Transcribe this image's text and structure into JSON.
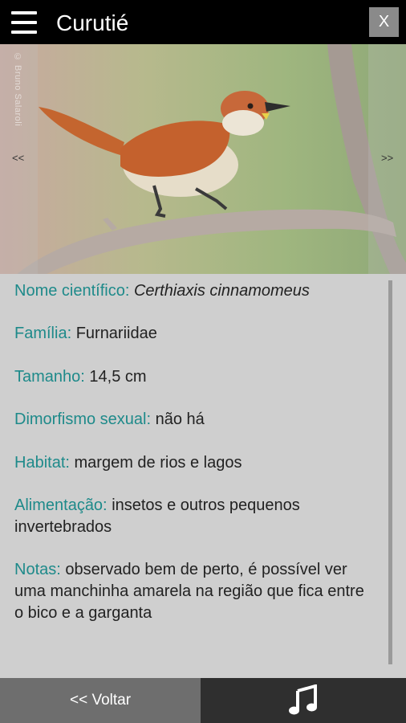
{
  "header": {
    "title": "Curutié",
    "close_label": "X",
    "menu_icon": "hamburger-menu-icon"
  },
  "photo": {
    "credit": "© Bruno Salaroli",
    "prev_label": "<<",
    "next_label": ">>"
  },
  "details": {
    "scientific_name": {
      "label": "Nome científico:",
      "value": "Certhiaxis cinnamomeus"
    },
    "family": {
      "label": "Família:",
      "value": "Furnariidae"
    },
    "size": {
      "label": "Tamanho:",
      "value": "14,5 cm"
    },
    "dimorphism": {
      "label": "Dimorfismo sexual:",
      "value": "não há"
    },
    "habitat": {
      "label": "Habitat:",
      "value": "margem de rios e lagos"
    },
    "feeding": {
      "label": "Alimentação:",
      "value": "insetos e outros pequenos invertebrados"
    },
    "notes": {
      "label": "Notas:",
      "value": "observado bem de perto, é possível ver uma manchinha amarela na região que fica entre o bico e a garganta"
    }
  },
  "footer": {
    "back_label": "<< Voltar",
    "sound_icon": "music-note-icon"
  },
  "colors": {
    "accent": "#1e8a8a",
    "top_bar": "#000000",
    "panel": "#cfcfcf",
    "back_button": "#6e6e6e",
    "bottom_bar": "#2f2f2f"
  }
}
